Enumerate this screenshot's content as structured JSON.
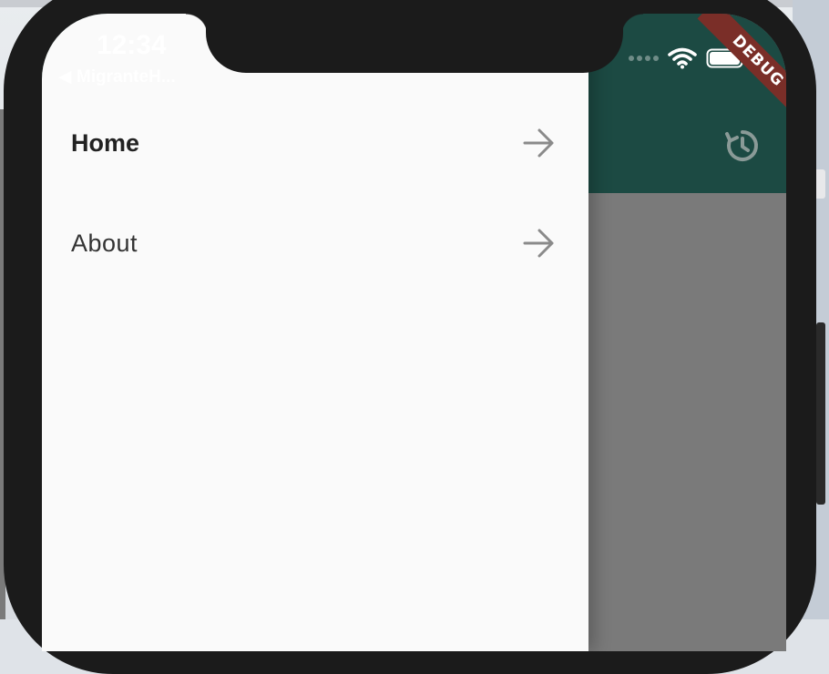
{
  "status_bar": {
    "time": "12:34",
    "back_label": "◀ MigranteH..."
  },
  "app_bar": {
    "color": "#1c4a43",
    "action_icon": "history-icon"
  },
  "debug_banner": {
    "label": "DEBUG",
    "color": "#7a2e28"
  },
  "drawer": {
    "items": [
      {
        "label": "Home",
        "selected": true,
        "icon": "arrow-forward-icon"
      },
      {
        "label": "About",
        "selected": false,
        "icon": "arrow-forward-icon"
      }
    ]
  }
}
